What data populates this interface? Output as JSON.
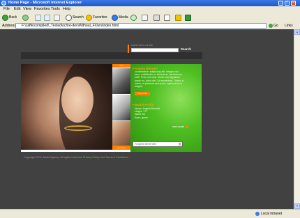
{
  "window": {
    "title": "Home Page - Microsoft Internet Explorer",
    "buttons": {
      "minimize": "_",
      "maximize": "□",
      "close": "×"
    }
  },
  "menu": [
    "File",
    "Edit",
    "View",
    "Favorites",
    "Tools",
    "Help"
  ],
  "toolbar": {
    "back": "Back",
    "search": "Search",
    "favorites": "Favorites",
    "media": "Media"
  },
  "address": {
    "label": "Address",
    "value": "F:\\Jaffe\\compiled\\_Tested\\ochre-dev\\Without_FX\\en\\index.html",
    "go": "Go",
    "links": "Links"
  },
  "status": {
    "zone": "Local intranet"
  },
  "site": {
    "search_hint": "search all in our site",
    "search_placeholder": "",
    "search_button": "Search",
    "thumbs_top": "next",
    "thumbs_bottom": "previous",
    "model_name": "Angela Bennett",
    "bio": "consectetuer adipiscing elit. Integer nisi urna, sollicitudin ut, lobortis at, faucibus ac, nibh. Proin vel urna. Morbi non dignissim turpis eu, tortor nisl. Ut fermentum. Donec a lorem, et placerat sed quam, eget purus ut magna.",
    "more_button": "more info",
    "profile_heading": "Model Profile",
    "profile_lines": [
      "Name: Angela Bennett",
      "Height: 177",
      "Waist: 60",
      "Eyes: green"
    ],
    "next_model": "next model",
    "select_value": "Angela Bennett",
    "copyright": "Copyright 2004, ModelAgency. All rights reserved.",
    "privacy_link": "Privacy Policy",
    "and": "and",
    "terms_link": "Terms & Conditions"
  },
  "colors": {
    "accent": "#ff7f00",
    "panel_green": "#4fbf22",
    "page_bg": "#414141"
  }
}
